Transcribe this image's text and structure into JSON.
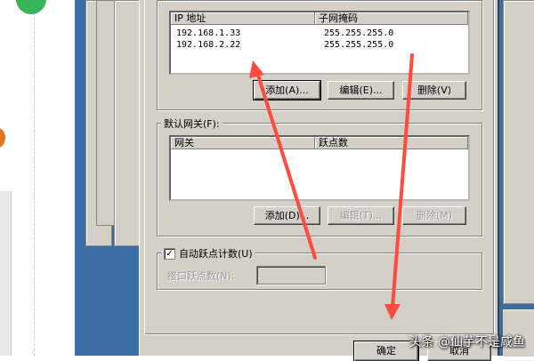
{
  "ip_section": {
    "header_ip": "IP 地址",
    "header_mask": "子网掩码",
    "rows": [
      {
        "ip": "192.168.1.33",
        "mask": "255.255.255.0"
      },
      {
        "ip": "192.168.2.22",
        "mask": "255.255.255.0"
      }
    ],
    "add_label": "添加(A)...",
    "edit_label": "编辑(E)...",
    "delete_label": "删除(V)"
  },
  "gateway_section": {
    "label": "默认网关(F):",
    "header_gateway": "网关",
    "header_metric": "跃点数",
    "add_label": "添加(D)...",
    "edit_label": "编辑(T)...",
    "delete_label": "删除(M)"
  },
  "metric_section": {
    "auto_metric_label": "自动跃点计数(U)",
    "auto_metric_checked": true,
    "interface_metric_label": "接口跃点数(N):",
    "interface_metric_value": ""
  },
  "footer": {
    "ok_label": "确定",
    "cancel_label": "取消"
  },
  "watermark": "头条 @仙芋不是咸鱼",
  "colors": {
    "desktop_blue": "#3a6ea5",
    "dialog_gray": "#d4d0c8",
    "arrow_red": "#ff4b3e"
  }
}
